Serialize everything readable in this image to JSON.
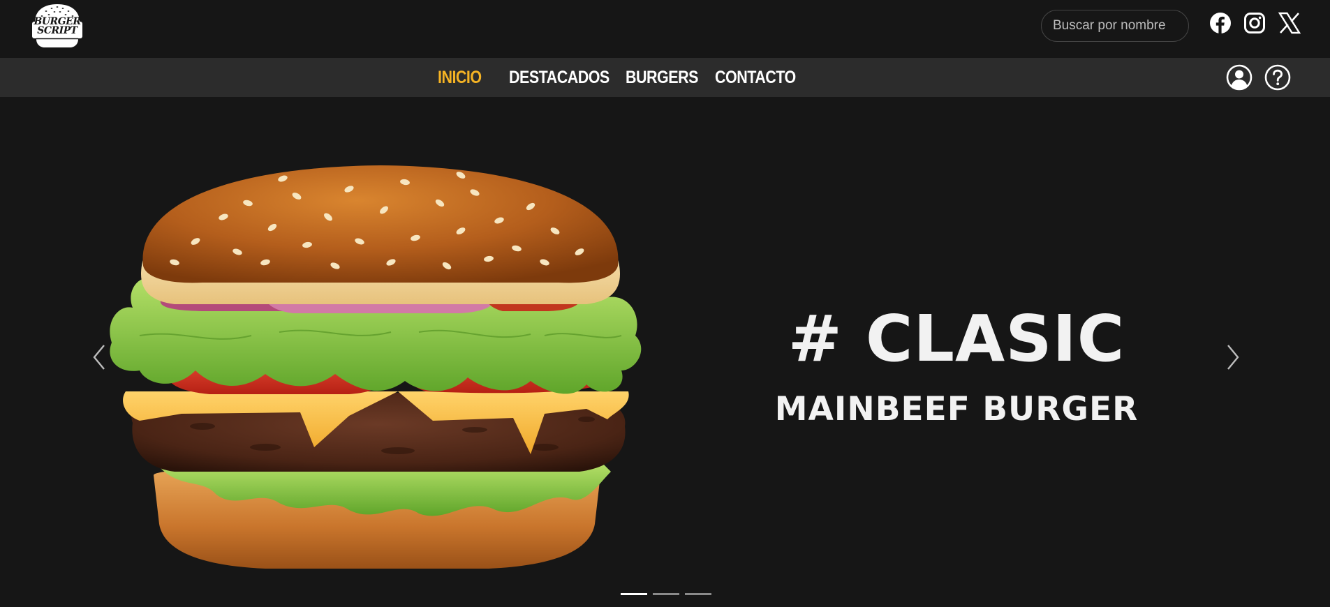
{
  "header": {
    "logo": {
      "line1": "BURGER",
      "line2": "SCRIPT",
      "icon": "burger-logo-icon"
    },
    "search": {
      "value": "",
      "placeholder": "Buscar por nombre"
    },
    "social": [
      {
        "name": "Facebook",
        "icon": "facebook-icon"
      },
      {
        "name": "Instagram",
        "icon": "instagram-icon"
      },
      {
        "name": "X",
        "icon": "x-icon"
      }
    ]
  },
  "nav": {
    "items": [
      {
        "label": "INICIO",
        "active": true
      },
      {
        "label": "DESTACADOS",
        "active": false
      },
      {
        "label": "BURGERS",
        "active": false
      },
      {
        "label": "CONTACTO",
        "active": false
      }
    ],
    "icons": [
      {
        "name": "user-account-icon"
      },
      {
        "name": "help-icon"
      }
    ]
  },
  "carousel": {
    "slide": {
      "title": "# CLASIC",
      "subtitle": "MAINBEEF BURGER",
      "image": "burger-image"
    },
    "prev_icon": "chevron-left-icon",
    "next_icon": "chevron-right-icon",
    "indicator_count": 3,
    "active_index": 0
  },
  "colors": {
    "background": "#161616",
    "navbar": "#2c2c2c",
    "accent": "#f5b324",
    "text": "#ffffff"
  }
}
